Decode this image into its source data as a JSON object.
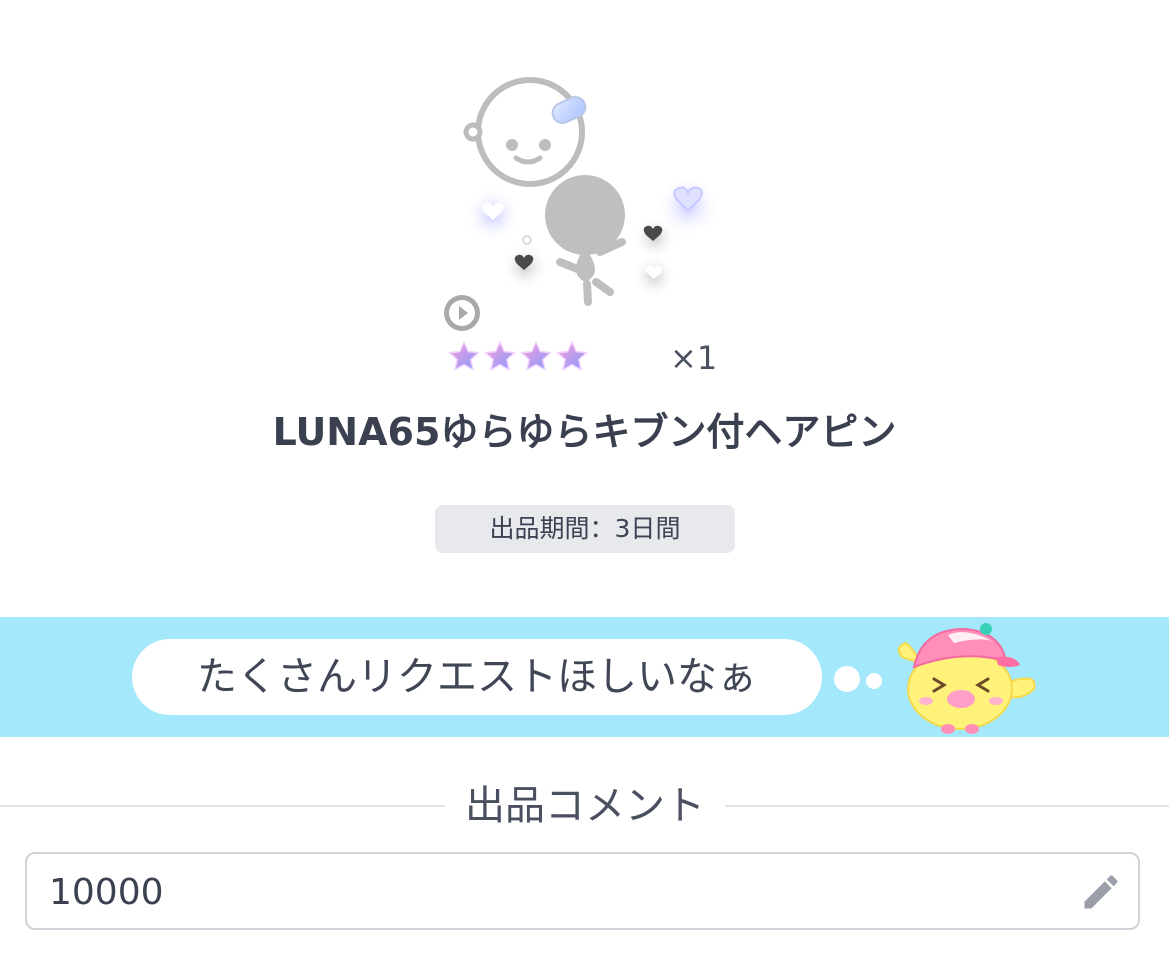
{
  "item": {
    "name": "LUNA65ゆらゆらキブン付ヘアピン",
    "quantity": "×1",
    "rarity_stars": 4,
    "preview_icon": "avatar-with-hairpin-and-hearts",
    "period_label": "出品期間：3日間"
  },
  "banner": {
    "message": "たくさんリクエストほしいなぁ",
    "mascot_icon": "bird-mascot-with-cap"
  },
  "comment_section": {
    "title": "出品コメント",
    "value": "10000",
    "edit_icon": "pencil-icon"
  },
  "colors": {
    "banner_bg": "#a4e8fb",
    "badge_bg": "#e7e9ed",
    "text": "#3a4050"
  }
}
